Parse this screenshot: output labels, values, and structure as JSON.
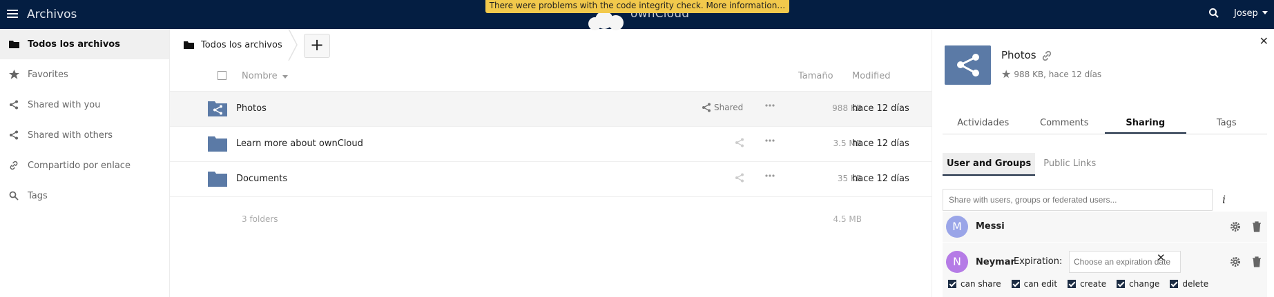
{
  "header": {
    "app_title": "Archivos",
    "logo_text": "ownCloud",
    "warning": "There were problems with the code integrity check. More information…",
    "user": "Josep"
  },
  "sidebar": {
    "items": [
      {
        "label": "Todos los archivos",
        "icon": "folder-icon",
        "active": true
      },
      {
        "label": "Favorites",
        "icon": "star-icon",
        "active": false
      },
      {
        "label": "Shared with you",
        "icon": "share-icon",
        "active": false
      },
      {
        "label": "Shared with others",
        "icon": "share-icon",
        "active": false
      },
      {
        "label": "Compartido por enlace",
        "icon": "link-icon",
        "active": false
      },
      {
        "label": "Tags",
        "icon": "tag-icon",
        "active": false
      }
    ]
  },
  "files": {
    "breadcrumb": "Todos los archivos",
    "add_label": "+",
    "columns": {
      "name": "Nombre",
      "size": "Tamaño",
      "modified": "Modified"
    },
    "rows": [
      {
        "name": "Photos",
        "share_label": "Shared",
        "size": "988 KB",
        "modified": "hace 12 días"
      },
      {
        "name": "Learn more about ownCloud",
        "share_label": "",
        "size": "3.5 MB",
        "modified": "hace 12 días"
      },
      {
        "name": "Documents",
        "share_label": "",
        "size": "35 KB",
        "modified": "hace 12 días"
      }
    ],
    "summary": {
      "folders": "3 folders",
      "total": "4.5 MB"
    }
  },
  "details": {
    "title": "Photos",
    "meta": "988 KB, hace 12 días",
    "tabs": [
      "Actividades",
      "Comments",
      "Sharing",
      "Tags"
    ],
    "active_tab": "Sharing",
    "subtabs": [
      "User and Groups",
      "Public Links"
    ],
    "active_subtab": "User and Groups",
    "share_placeholder": "Share with users, groups or federated users...",
    "shares": [
      {
        "initial": "M",
        "name": "Messi",
        "avatar_color": "#9aa5e8"
      },
      {
        "initial": "N",
        "name": "Neymar",
        "avatar_color": "#b57be6",
        "expiration_label": "Expiration:",
        "expiration_placeholder": "Choose an expiration date",
        "permissions": [
          "can share",
          "can edit",
          "create",
          "change",
          "delete"
        ]
      }
    ]
  },
  "colors": {
    "header": "#041e42",
    "folder": "#5b7aa6",
    "warning": "#f2c94c"
  }
}
